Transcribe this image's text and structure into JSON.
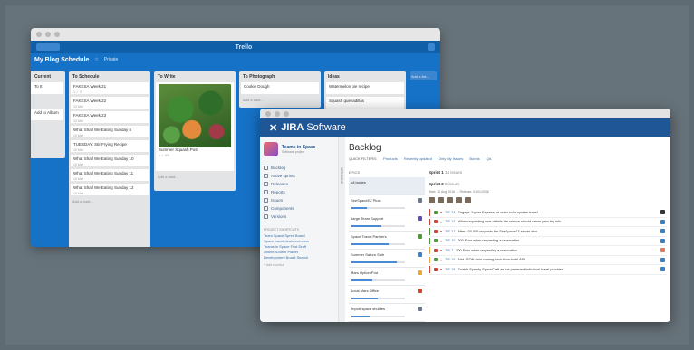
{
  "trello": {
    "logo": "Trello",
    "board_name": "My Blog Schedule",
    "board_meta": "Private",
    "add_list_label": "Add a list...",
    "lists": [
      {
        "title": "Current",
        "cards": [
          {
            "text": "To It"
          },
          {
            "text": "Add to Album"
          }
        ],
        "add_card": ""
      },
      {
        "title": "To Schedule",
        "cards": [
          {
            "text": "FAKESA Week 21",
            "meta": "1 ✓ 3"
          },
          {
            "text": "FAKESA Week 22",
            "meta": "10 Mar"
          },
          {
            "text": "FAKESA Week 23",
            "meta": "10 Mar"
          },
          {
            "text": "What Shall We Eating Sunday 6",
            "meta": "10 Mar"
          },
          {
            "text": "TUESDAY: Stir Frying Recipe",
            "meta": "10 Mar"
          },
          {
            "text": "What Shall We Eating Sunday 10",
            "meta": "10 Mar"
          },
          {
            "text": "What Shall We Eating Sunday 11",
            "meta": "10 Mar"
          },
          {
            "text": "What Shall We Eating Sunday 12",
            "meta": "10 Mar"
          }
        ],
        "add_card": "Add a card..."
      },
      {
        "title": "To Write",
        "cards": [
          {
            "text": "Summer Squash Post",
            "meta": "1 ✓ 0/3"
          }
        ],
        "add_card": "Add a card..."
      },
      {
        "title": "To Photograph",
        "cards": [
          {
            "text": "Cookie Dough"
          }
        ],
        "add_card": "Add a card..."
      },
      {
        "title": "Ideas",
        "cards": [
          {
            "text": "Watermelon pie recipe"
          },
          {
            "text": "Squash quesadillas"
          }
        ],
        "add_card": ""
      }
    ]
  },
  "jira": {
    "logo_prefix": "JIRA",
    "logo_suffix": "Software",
    "project": {
      "name": "Teams in Space",
      "subtitle": "Software project"
    },
    "nav": [
      "Backlog",
      "Active sprints",
      "Releases",
      "Reports",
      "Issues",
      "Components",
      "Versions"
    ],
    "shortcuts_title": "PROJECT SHORTCUTS",
    "shortcuts": [
      "Team Space Sprint Board",
      "Space travel deals overview",
      "Teams in Space First Draft",
      "Online Source Planet",
      "Development Board Search"
    ],
    "shortcuts_more": "+ Add shortcut",
    "side_tab": "VERSIONS",
    "page_title": "Backlog",
    "quick_filters": [
      "QUICK FILTERS:",
      "Products",
      "Recently updated",
      "Only My Issues",
      "Bonus",
      "QA"
    ],
    "epics_title": "EPICS",
    "epics": [
      {
        "name": "All issues",
        "progress": 0,
        "color": ""
      },
      {
        "name": "SeeSpaceEZ Plus",
        "progress": 0.3,
        "color": "#6b778c"
      },
      {
        "name": "Large Team Support",
        "progress": 0.55,
        "color": "#5e4db2"
      },
      {
        "name": "Space Travel Partners",
        "progress": 0.7,
        "color": "#4a9a3a"
      },
      {
        "name": "Summer Saturn Sale",
        "progress": 0.85,
        "color": "#3b7fc4"
      },
      {
        "name": "Mars Option Pod",
        "progress": 0.4,
        "color": "#e5a93c"
      },
      {
        "name": "Local Mars Office",
        "progress": 0.5,
        "color": "#d04437"
      },
      {
        "name": "Import space shuttles",
        "progress": 0.35,
        "color": "#6b778c"
      }
    ],
    "sprint1": {
      "name": "Sprint 1",
      "count": "14 issues"
    },
    "sprint2": {
      "name": "Sprint 2",
      "count": "8 issues",
      "dates": "Start: 12 Aug 2016 → Release: 01/01/2016"
    },
    "issues": [
      {
        "key": "TIS-23",
        "summary": "Engage Jupiter Express for outer solar system travel",
        "type_color": "#4a9a3a",
        "edge": "#d04437",
        "end": "#333333"
      },
      {
        "key": "TIS-12",
        "summary": "When requesting user details the service should return prior trip info",
        "type_color": "#d04437",
        "edge": "#d04437",
        "end": "#3b7fc4"
      },
      {
        "key": "TIS-17",
        "summary": "After 100,000 requests the SeeSpaceEZ server dies",
        "type_color": "#d04437",
        "edge": "#4a9a3a",
        "end": "#3b7fc4"
      },
      {
        "key": "TIS-10",
        "summary": "500 Error when requesting a reservation",
        "type_color": "#4a9a3a",
        "edge": "#4a9a3a",
        "end": "#3b7fc4"
      },
      {
        "key": "TIS-7",
        "summary": "500 Error when requesting a reservation",
        "type_color": "#d04437",
        "edge": "#e5a93c",
        "end": "#e07a5f"
      },
      {
        "key": "TIS-16",
        "summary": "Add JSON data coming back from hotel API",
        "type_color": "#4a9a3a",
        "edge": "#e5a93c",
        "end": "#3b7fc4"
      },
      {
        "key": "TIS-18",
        "summary": "Enable Speedy SpaceCraft as the preferred individual travel provider",
        "type_color": "#d04437",
        "edge": "#d04437",
        "end": "#3b7fc4"
      }
    ]
  }
}
